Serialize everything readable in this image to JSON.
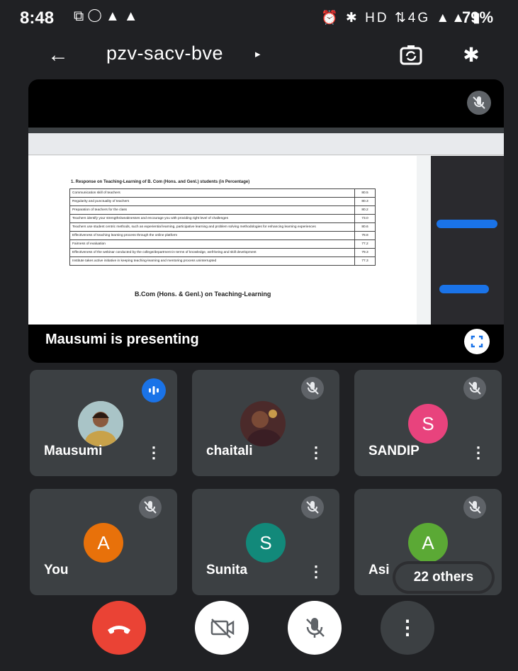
{
  "status_bar": {
    "time": "8:48",
    "left_icons": [
      "cast-icon",
      "whatsapp-icon",
      "warning-icon",
      "warning-icon"
    ],
    "right_icons": "⏰ ✱ HD ⇅4G ▲▲ ▮",
    "battery": "79%"
  },
  "top_bar": {
    "meeting_code": "pzv-sacv-bve",
    "chevron": "▸"
  },
  "presentation": {
    "presenter_label": "Mausumi is presenting",
    "document": {
      "section_title": "1.   Response on Teaching-Learning of B. Com (Hons. and Genl.) students (in Percentage)",
      "rows": [
        {
          "criterion": "Communication skill of teachers",
          "value": "80.5"
        },
        {
          "criterion": "Regularity and punctuality of teachers",
          "value": "80.3"
        },
        {
          "criterion": "Preparation of teachers for the class",
          "value": "80.2"
        },
        {
          "criterion": "Teachers identify your strengths/weaknesses and encourage you with providing right level of challenges",
          "value": "73.0"
        },
        {
          "criterion": "Teachers use student centric methods, such as experiential learning, participative learning and problem solving methodologies for enhancing learning experiences",
          "value": "80.6"
        },
        {
          "criterion": "Effectiveness of teaching learning process through the online platform",
          "value": "78.8"
        },
        {
          "criterion": "Fairness of evaluation",
          "value": "77.2"
        },
        {
          "criterion": "Effectiveness of the webinar conducted by the college/department in terms of knowledge, well-being and skill development",
          "value": "79.3"
        },
        {
          "criterion": "Institute takes active initiative in keeping teaching-learning and mentoring process uninterrupted",
          "value": "77.3"
        }
      ],
      "caption": "B.Com (Hons. & Genl.) on Teaching-Learning"
    }
  },
  "participants": [
    {
      "name": "Mausumi",
      "avatar": "photo",
      "speaking": true
    },
    {
      "name": "chaitali",
      "avatar": "photo",
      "muted": true
    },
    {
      "name": "SANDIP",
      "initial": "S",
      "color": "#e8437d",
      "muted": true
    },
    {
      "name": "You",
      "initial": "A",
      "color": "#e8710a",
      "muted": true
    },
    {
      "name": "Sunita",
      "initial": "S",
      "color": "#12897a",
      "muted": true
    },
    {
      "name": "Asi",
      "initial": "A",
      "color": "#5ba935",
      "muted": true
    }
  ],
  "others_count": "22 others",
  "colors": {
    "background": "#202124",
    "tile": "#3c4043",
    "end_call": "#ea4335",
    "accent": "#1a73e8"
  }
}
